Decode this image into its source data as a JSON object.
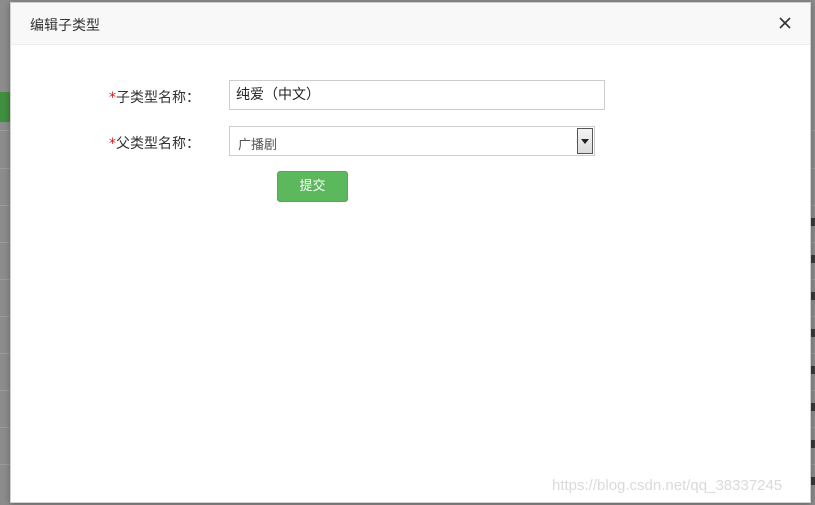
{
  "modal": {
    "title": "编辑子类型",
    "close_label": "×"
  },
  "form": {
    "required_mark": "*",
    "subtype_name_label": "子类型名称：",
    "subtype_name_value": "纯爱（中文）",
    "parent_type_label": "父类型名称：",
    "parent_type_selected": "广播剧",
    "submit_label": "提交"
  },
  "watermark": "https://blog.csdn.net/qq_38337245",
  "colors": {
    "accent_green": "#5cb85c",
    "required_red": "#d9161c"
  }
}
